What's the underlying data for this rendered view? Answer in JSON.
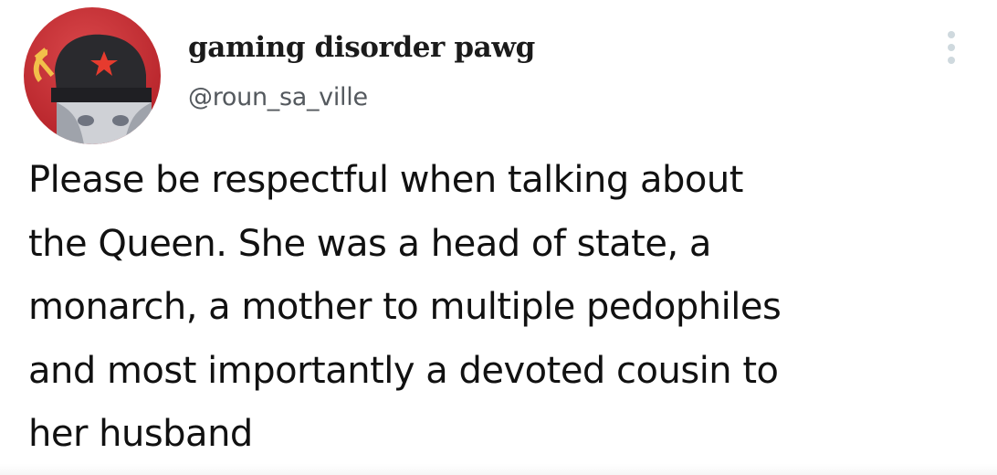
{
  "tweet": {
    "author": {
      "display_name": "gaming disorder pawg",
      "handle": "@roun_sa_ville",
      "avatar_icon": "hammer-and-sickle-avatar"
    },
    "more_icon": "vertical-ellipsis-icon",
    "text": "Please be respectful when talking about\nthe Queen. She was a head of state, a\nmonarch, a mother to multiple pedophiles\nand most importantly a devoted cousin to\nher husband"
  },
  "colors": {
    "avatar_background": "#c8272d",
    "display_name": "#1b1b1b",
    "handle": "#54595e",
    "text": "#111111",
    "more_icon": "#cfd9de"
  }
}
